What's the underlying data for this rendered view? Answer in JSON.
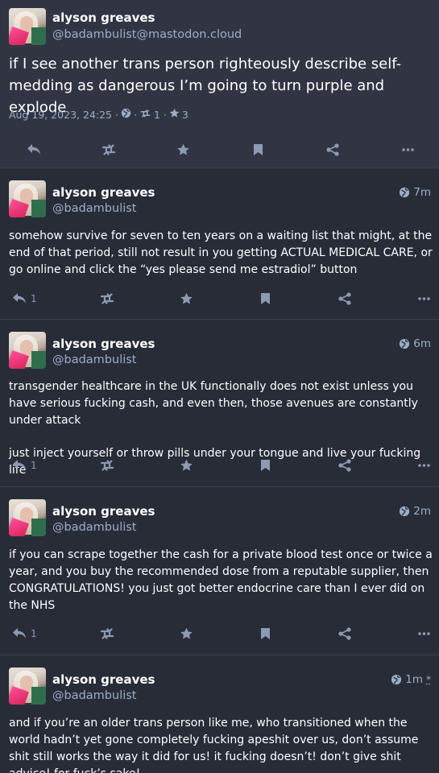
{
  "focal": {
    "display_name": "alyson greaves",
    "handle": "@badambulist@mastodon.cloud",
    "text": "if I see another trans person righteously describe self-medding as dangerous I’m going to turn purple and explode",
    "date": "Aug 19, 2023, 24:25 ·",
    "sep": "·",
    "boosts": "1 ·",
    "favourites": "3"
  },
  "replies": [
    {
      "display_name": "alyson greaves",
      "handle": "@badambulist",
      "time": "7m",
      "paragraphs": [
        "somehow survive for seven to ten years on a waiting list that might, at the end of that period, still not result in you getting ACTUAL MEDICAL CARE, or go online and click the “yes please send me estradiol” button"
      ],
      "reply_count": "1"
    },
    {
      "display_name": "alyson greaves",
      "handle": "@badambulist",
      "time": "6m",
      "paragraphs": [
        "transgender healthcare in the UK functionally does not exist unless you have serious fucking cash, and even then, those avenues are constantly under attack",
        "just inject yourself or throw pills under your tongue and live your fucking life"
      ],
      "reply_count": "1"
    },
    {
      "display_name": "alyson greaves",
      "handle": "@badambulist",
      "time": "2m",
      "paragraphs": [
        "if you can scrape together the cash for a private blood test once or twice a year, and you buy the recommended dose from a reputable supplier, then CONGRATULATIONS! you just got better endocrine care than I ever did on the NHS"
      ],
      "reply_count": "1"
    },
    {
      "display_name": "alyson greaves",
      "handle": "@badambulist",
      "time": "1m",
      "edited_marker": "*",
      "paragraphs": [
        "and if you’re an older trans person like me, who transitioned when the world hadn’t yet gone completely fucking apeshit over us, don’t assume shit still works the way it did for us! it fucking doesn’t! don’t give shit advice! for fuck’s sake!"
      ]
    }
  ],
  "icons": {
    "reply": "reply-icon",
    "boost": "boost-icon",
    "favourite": "star-icon",
    "bookmark": "bookmark-icon",
    "share": "share-icon",
    "more": "more-icon",
    "visibility": "globe-icon"
  },
  "colors": {
    "background": "#282c37",
    "focal_background": "#313543",
    "secondary_text": "#9baec8",
    "icon": "#8d9ab3"
  }
}
